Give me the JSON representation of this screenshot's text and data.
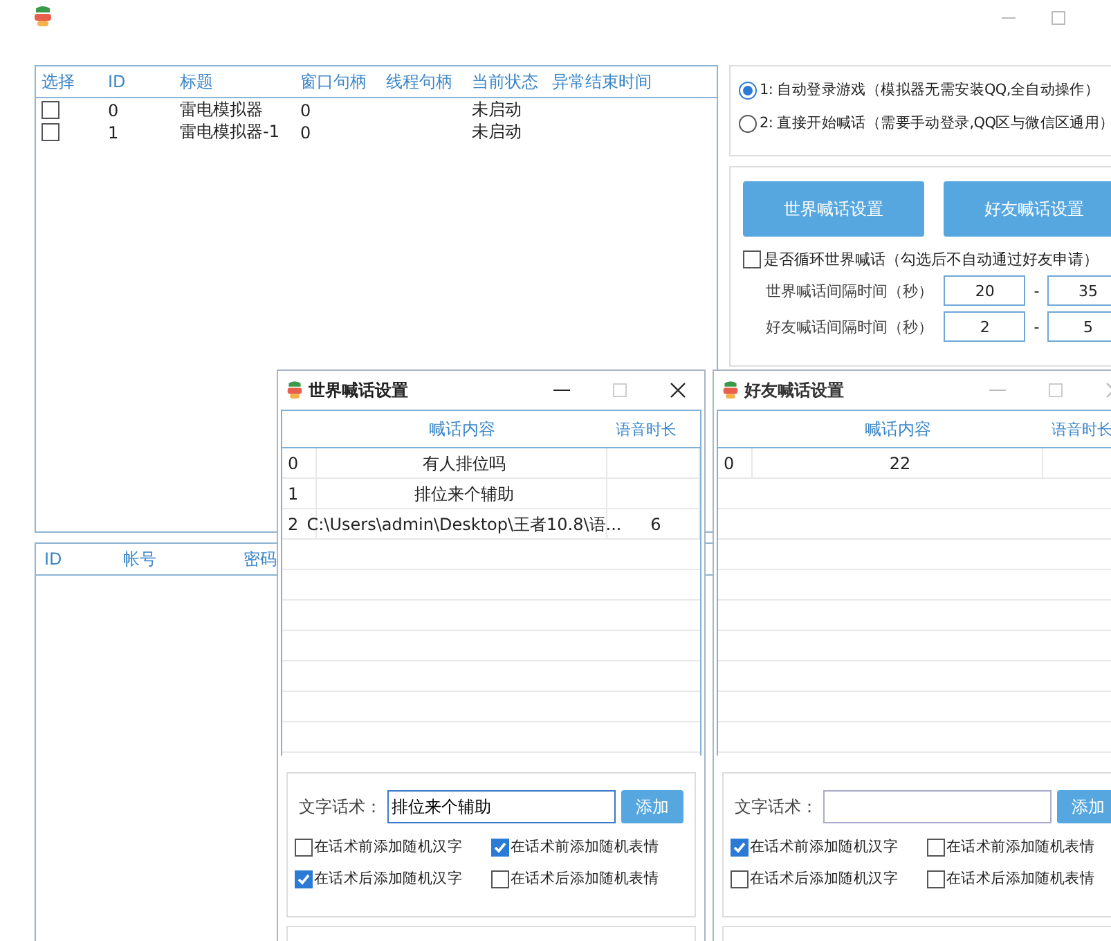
{
  "main_table": {
    "select_column": "选择",
    "columns": [
      "ID",
      "标题",
      "窗口句柄",
      "线程句柄",
      "当前状态",
      "异常结束时间"
    ],
    "rows": [
      {
        "checked": false,
        "cells": [
          "0",
          "雷电模拟器",
          "0",
          "",
          "未启动",
          ""
        ]
      },
      {
        "checked": false,
        "cells": [
          "1",
          "雷电模拟器-1",
          "0",
          "",
          "未启动",
          ""
        ]
      }
    ]
  },
  "account_table": {
    "columns": [
      "ID",
      "帐号",
      "密码"
    ]
  },
  "modes": [
    {
      "label": "1: 自动登录游戏（模拟器无需安装QQ,全自动操作）",
      "selected": true
    },
    {
      "label": "2: 直接开始喊话（需要手动登录,QQ区与微信区通用）",
      "selected": false
    }
  ],
  "setting_buttons": [
    "世界喊话设置",
    "好友喊话设置"
  ],
  "loop_option": {
    "label": "是否循环世界喊话（勾选后不自动通过好友申请）",
    "checked": false
  },
  "intervals": [
    {
      "label": "世界喊话间隔时间（秒）",
      "min": "20",
      "separator": "-",
      "max": "35"
    },
    {
      "label": "好友喊话间隔时间（秒）",
      "min": "2",
      "separator": "-",
      "max": "5"
    }
  ],
  "dialogs": [
    {
      "title": "世界喊话设置",
      "active": true,
      "columns": [
        "喊话内容",
        "语音时长"
      ],
      "rows": [
        {
          "index": "0",
          "content": "有人排位吗",
          "duration": ""
        },
        {
          "index": "1",
          "content": "排位来个辅助",
          "duration": ""
        },
        {
          "index": "2",
          "content": "C:\\Users\\admin\\Desktop\\王者10.8\\语...",
          "duration": "6"
        }
      ],
      "text_label": "文字话术：",
      "text_value": "排位来个辅助",
      "add_button": "添加",
      "options": [
        {
          "label": "在话术前添加随机汉字",
          "checked": false
        },
        {
          "label": "在话术前添加随机表情",
          "checked": true
        },
        {
          "label": "在话术后添加随机汉字",
          "checked": true
        },
        {
          "label": "在话术后添加随机表情",
          "checked": false
        }
      ]
    },
    {
      "title": "好友喊话设置",
      "active": false,
      "columns": [
        "喊话内容",
        "语音时长"
      ],
      "rows": [
        {
          "index": "0",
          "content": "22",
          "duration": ""
        }
      ],
      "text_label": "文字话术：",
      "add_button": "添加",
      "options": [
        {
          "label": "在话术前添加随机汉字",
          "checked": true
        },
        {
          "label": "在话术前添加随机表情",
          "checked": false
        },
        {
          "label": "在话术后添加随机汉字",
          "checked": false
        },
        {
          "label": "在话术后添加随机表情",
          "checked": false
        }
      ]
    }
  ]
}
